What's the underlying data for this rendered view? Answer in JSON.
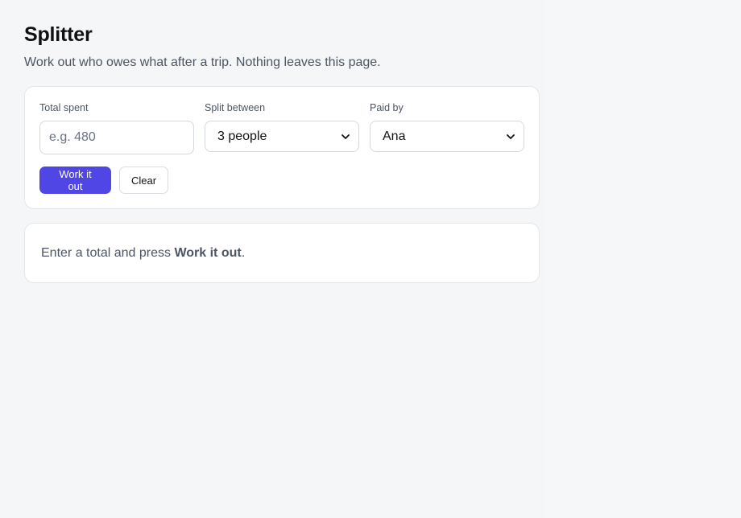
{
  "header": {
    "title": "Splitter",
    "subtitle": "Work out who owes what after a trip. Nothing leaves this page."
  },
  "form": {
    "total": {
      "label": "Total spent",
      "value": "",
      "placeholder": "e.g. 480"
    },
    "split": {
      "label": "Split between",
      "selected": "3 people"
    },
    "paid_by": {
      "label": "Paid by",
      "selected": "Ana"
    },
    "buttons": {
      "work_label": "Work it out",
      "clear_label": "Clear"
    }
  },
  "result": {
    "prefix": "Enter a total and press ",
    "emphasis": "Work it out",
    "suffix": "."
  },
  "colors": {
    "accent": "#4f46e5",
    "background": "#f5f6f7",
    "card": "#ffffff"
  },
  "icons": {
    "select_chevron": "chevron-down-icon"
  }
}
